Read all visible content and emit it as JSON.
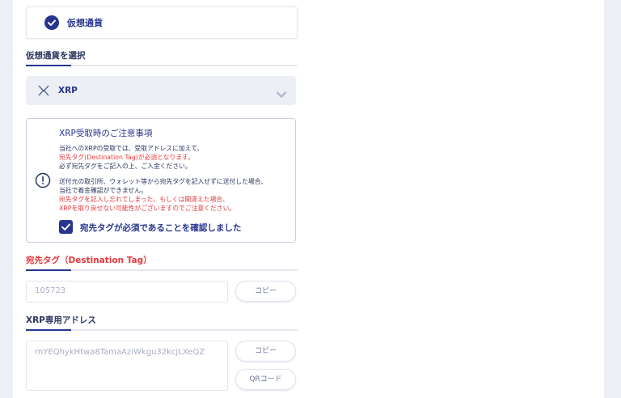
{
  "currency_card": {
    "label": "仮想通貨"
  },
  "select_section": {
    "title": "仮想通貨を選択"
  },
  "selector": {
    "value": "XRP",
    "icon": "xrp-icon"
  },
  "notice": {
    "title": "XRP受取時のご注意事項",
    "lines1": [
      {
        "text": "当社へのXRPの受取では、受取アドレスに加えて、",
        "color": "blue"
      },
      {
        "text": "宛先タグ(Destination Tag)が必須となります。",
        "color": "red"
      },
      {
        "text": "必ず宛先タグをご記入の上、ご入金ください。",
        "color": "blue"
      }
    ],
    "lines2": [
      {
        "text": "送付元の取引所、ウォレット等から宛先タグを記入せずに送付した場合、",
        "color": "blue"
      },
      {
        "text": "当社で着金確認ができません。",
        "color": "blue"
      },
      {
        "text": "宛先タグを記入し忘れてしまった、もしくは間違えた場合、",
        "color": "red"
      },
      {
        "text": "XRPを取り戻せない可能性がございますのでご注意ください。",
        "color": "red"
      }
    ],
    "checkbox_label": "宛先タグが必須であることを確認しました",
    "checked": true
  },
  "destination_tag": {
    "title": "宛先タグ（Destination Tag）",
    "value": "105723",
    "copy_label": "コピー"
  },
  "address": {
    "title": "XRP専用アドレス",
    "value": "rnYEQhykHtwa8TamaAziWkgu32kcjLXeQZ",
    "copy_label": "コピー",
    "qr_label": "QRコード"
  },
  "colors": {
    "primary": "#27358f",
    "danger": "#e4383b",
    "muted": "#a7adc4"
  }
}
